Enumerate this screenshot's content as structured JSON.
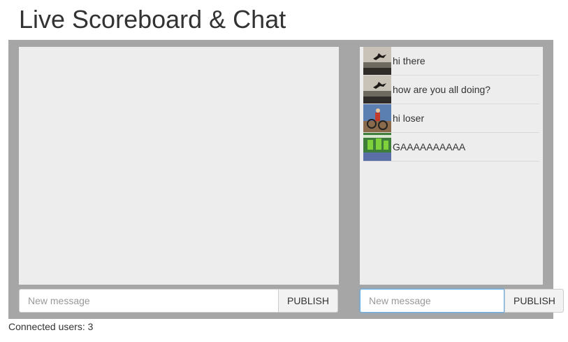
{
  "page": {
    "title": "Live Scoreboard & Chat",
    "connected_users_text": "Connected users: 3"
  },
  "scoreboard": {
    "input_placeholder": "New message",
    "publish_label": "PUBLISH"
  },
  "chat": {
    "messages": [
      {
        "avatar": "jumping-person-avatar",
        "text": "hi there"
      },
      {
        "avatar": "jumping-person-avatar",
        "text": "how are you all doing?"
      },
      {
        "avatar": "bmx-rider-avatar",
        "text": "hi loser"
      },
      {
        "avatar": "cyclists-avatar",
        "text": "GAAAAAAAAAA"
      }
    ],
    "input_placeholder": "New message",
    "publish_label": "PUBLISH"
  },
  "colors": {
    "frame": "#a6a6a6",
    "panel": "#ededed",
    "focus_border": "#66afe9"
  }
}
